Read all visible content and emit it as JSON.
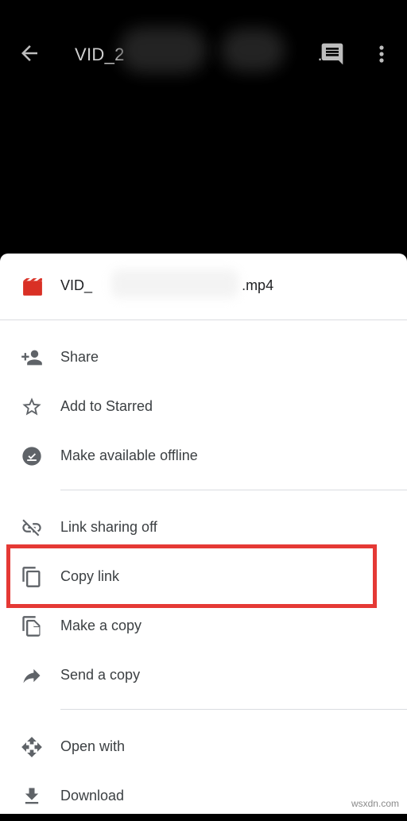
{
  "header": {
    "title": "VID_2",
    "title_suffix": "..."
  },
  "sheet": {
    "file_name_prefix": "VID_",
    "file_name_suffix": ".mp4",
    "items": [
      {
        "label": "Share",
        "icon": "person-add-icon"
      },
      {
        "label": "Add to Starred",
        "icon": "star-outline-icon"
      },
      {
        "label": "Make available offline",
        "icon": "offline-check-icon"
      },
      {
        "label": "Link sharing off",
        "icon": "link-off-icon"
      },
      {
        "label": "Copy link",
        "icon": "copy-icon"
      },
      {
        "label": "Make a copy",
        "icon": "file-copy-icon"
      },
      {
        "label": "Send a copy",
        "icon": "send-arrow-icon"
      },
      {
        "label": "Open with",
        "icon": "open-with-icon"
      },
      {
        "label": "Download",
        "icon": "download-icon"
      }
    ],
    "highlighted_item": "Copy link"
  },
  "watermark": "wsxdn.com",
  "colors": {
    "background": "#000000",
    "sheet": "#ffffff",
    "file_icon": "#d93025",
    "highlight": "#e53935",
    "icon_gray": "#5f6368"
  }
}
